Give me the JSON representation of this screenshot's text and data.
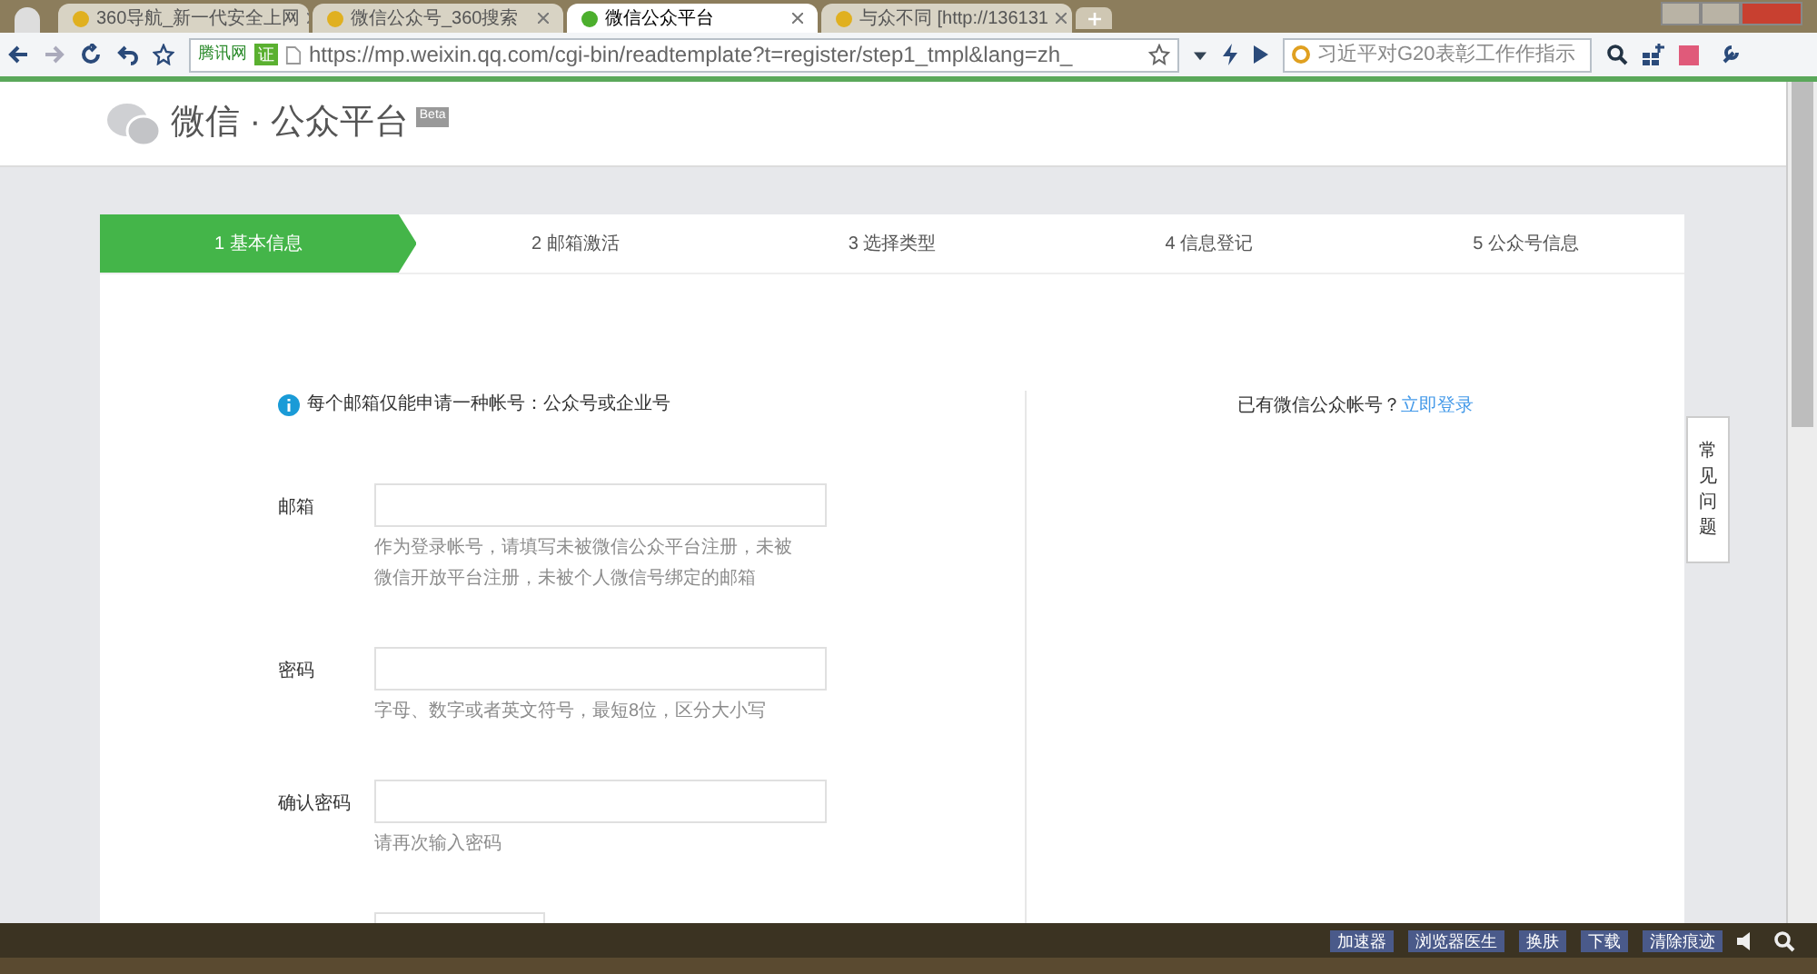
{
  "browser": {
    "tabs": [
      {
        "title": "360导航_新一代安全上网",
        "selected": false
      },
      {
        "title": "微信公众号_360搜索",
        "selected": false
      },
      {
        "title": "微信公众平台",
        "selected": true
      },
      {
        "title": "与众不同 [http://136131",
        "selected": false
      }
    ],
    "address_badge": "腾讯网",
    "cert_badge": "证",
    "url": "https://mp.weixin.qq.com/cgi-bin/readtemplate?t=register/step1_tmpl&lang=zh_",
    "search_value": "习近平对G20表彰工作作指示"
  },
  "header": {
    "title": "微信 · 公众平台",
    "badge": "Beta"
  },
  "steps": [
    {
      "label": "1 基本信息",
      "selected": true
    },
    {
      "label": "2 邮箱激活",
      "selected": false
    },
    {
      "label": "3 选择类型",
      "selected": false
    },
    {
      "label": "4 信息登记",
      "selected": false
    },
    {
      "label": "5 公众号信息",
      "selected": false
    }
  ],
  "notice": "每个邮箱仅能申请一种帐号：公众号或企业号",
  "fields": [
    {
      "label": "邮箱",
      "hint": "作为登录帐号，请填写未被微信公众平台注册，未被微信开放平台注册，未被个人微信号绑定的邮箱",
      "kind": "wide"
    },
    {
      "label": "密码",
      "hint": "字母、数字或者英文符号，最短8位，区分大小写",
      "kind": "wide"
    },
    {
      "label": "确认密码",
      "hint": "请再次输入密码",
      "kind": "wide"
    },
    {
      "kind": "short"
    }
  ],
  "login_prompt": "已有微信公众帐号？",
  "login_link": "立即登录",
  "faq": "常见问题",
  "status_bar": [
    "加速器",
    "浏览器医生",
    "换肤",
    "下载",
    "清除痕迹"
  ]
}
